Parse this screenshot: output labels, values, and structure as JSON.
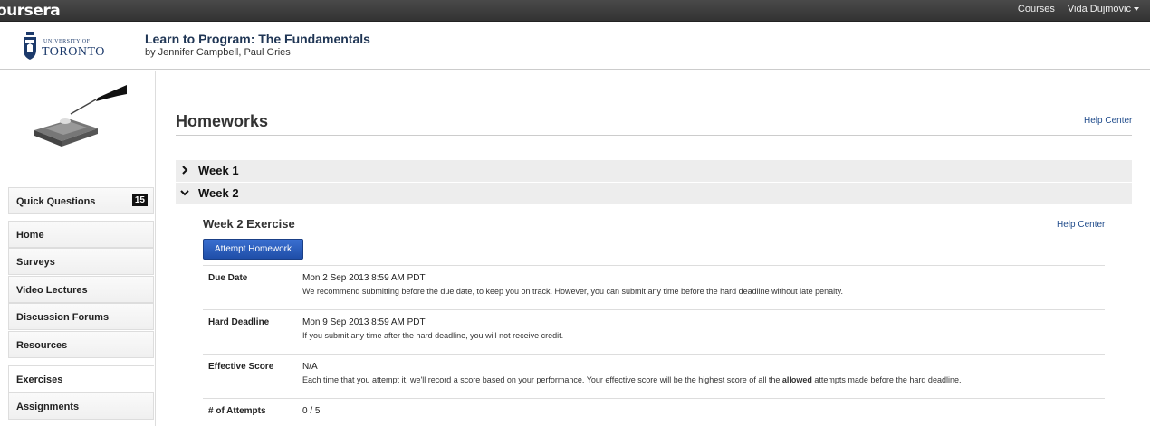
{
  "topbar": {
    "brand": "oursera",
    "courses": "Courses",
    "user": "Vida Dujmovic"
  },
  "header": {
    "logo_small": "UNIVERSITY OF",
    "logo_big": "TORONTO",
    "course_title": "Learn to Program: The Fundamentals",
    "course_authors": "by Jennifer Campbell, Paul Gries"
  },
  "sidebar": {
    "search_placeholder": "",
    "quick_questions": {
      "label": "Quick Questions",
      "count": "15"
    },
    "items": [
      {
        "label": "Home"
      },
      {
        "label": "Surveys"
      },
      {
        "label": "Video Lectures"
      },
      {
        "label": "Discussion Forums"
      },
      {
        "label": "Resources"
      },
      {
        "label": "Exercises"
      },
      {
        "label": "Assignments"
      }
    ]
  },
  "main": {
    "page_title": "Homeworks",
    "help_center": "Help Center",
    "weeks": [
      {
        "label": "Week 1",
        "expanded": false
      },
      {
        "label": "Week 2",
        "expanded": true
      }
    ],
    "exercise": {
      "title": "Week 2 Exercise",
      "help_center": "Help Center",
      "attempt_button": "Attempt Homework",
      "rows": [
        {
          "label": "Due Date",
          "value": "Mon 2 Sep 2013 8:59 AM PDT",
          "note": "We recommend submitting before the due date, to keep you on track. However, you can submit any time before the hard deadline without late penalty."
        },
        {
          "label": "Hard Deadline",
          "value": "Mon 9 Sep 2013 8:59 AM PDT",
          "note": "If you submit any time after the hard deadline, you will not receive credit."
        },
        {
          "label": "Effective Score",
          "value": "N/A",
          "note_before": "Each time that you attempt it, we'll record a score based on your performance. Your effective score will be the highest score of all the ",
          "note_bold": "allowed",
          "note_after": " attempts made before the hard deadline."
        },
        {
          "label": "# of Attempts",
          "value": "0 / 5"
        }
      ]
    }
  }
}
